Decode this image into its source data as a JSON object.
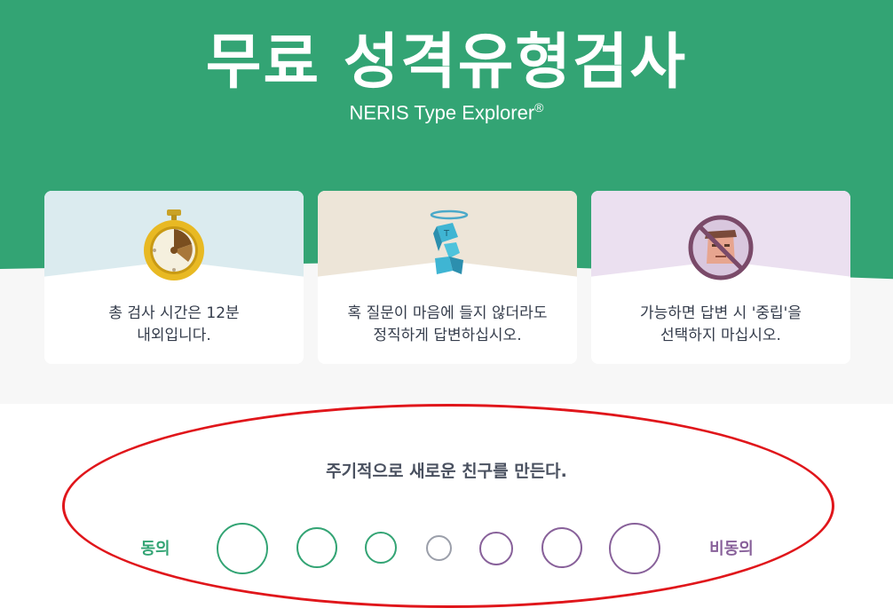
{
  "header": {
    "title": "무료 성격유형검사",
    "subtitle": "NERIS Type Explorer",
    "subtitle_mark": "®",
    "background_color": "#33a474"
  },
  "cards": [
    {
      "icon": "stopwatch-icon",
      "text_line1": "총 검사 시간은 12분",
      "text_line2": "내외입니다.",
      "background_color": "#dbebef"
    },
    {
      "icon": "angel-cube-icon",
      "text_line1": "혹 질문이 마음에 들지 않더라도",
      "text_line2": "정직하게 답변하십시오.",
      "background_color": "#ede5d8"
    },
    {
      "icon": "no-neutral-face-icon",
      "text_line1": "가능하면 답변 시 '중립'을",
      "text_line2": "선택하지 마십시오.",
      "background_color": "#ebe0f0"
    }
  ],
  "question": {
    "text": "주기적으로 새로운 친구를 만든다.",
    "agree_label": "동의",
    "disagree_label": "비동의",
    "agree_color": "#33a474",
    "neutral_color": "#9b9faa",
    "disagree_color": "#88619a",
    "options": [
      {
        "id": "agree-3",
        "tone": "agree"
      },
      {
        "id": "agree-2",
        "tone": "agree"
      },
      {
        "id": "agree-1",
        "tone": "agree"
      },
      {
        "id": "neutral",
        "tone": "neutral"
      },
      {
        "id": "disagree-1",
        "tone": "disagree"
      },
      {
        "id": "disagree-2",
        "tone": "disagree"
      },
      {
        "id": "disagree-3",
        "tone": "disagree"
      }
    ]
  },
  "annotation_color": "#e0161b"
}
